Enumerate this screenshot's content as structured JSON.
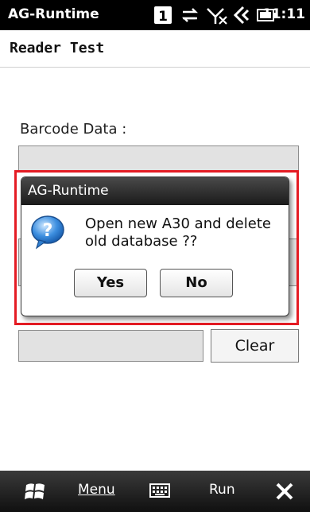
{
  "statusbar": {
    "app_title": "AG-Runtime",
    "badge_number": "1",
    "time": "11:11"
  },
  "header": {
    "title": "Reader Test"
  },
  "form": {
    "barcode_label": "Barcode Data :",
    "clear_label": "Clear"
  },
  "dialog": {
    "title": "AG-Runtime",
    "message_line1": "Open new A30 and delete",
    "message_line2": "old database ??",
    "yes_label": "Yes",
    "no_label": "No"
  },
  "bottombar": {
    "menu_label": "Menu",
    "run_label": "Run"
  },
  "colors": {
    "highlight_outline": "#e41b23",
    "statusbar_bg": "#000000"
  }
}
